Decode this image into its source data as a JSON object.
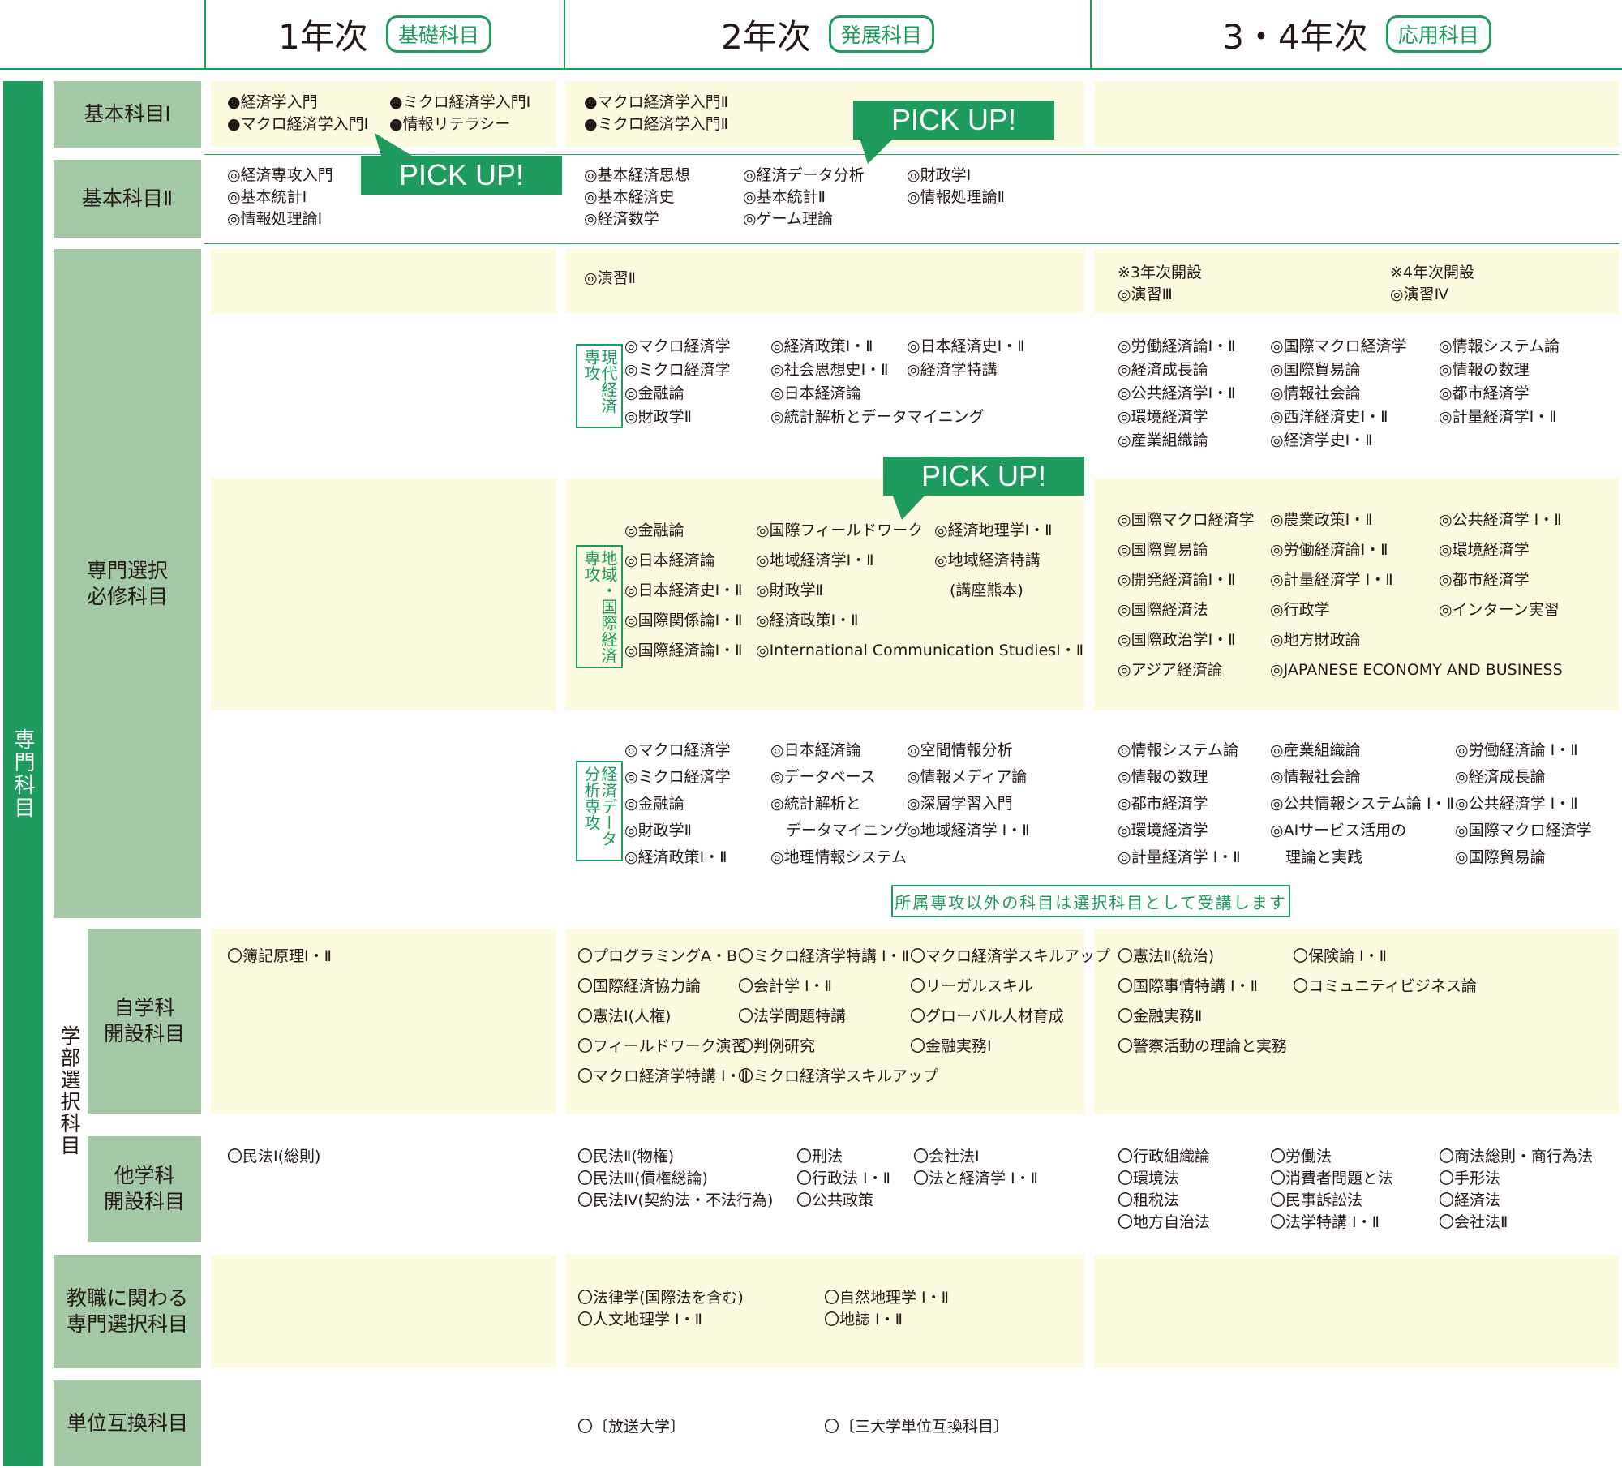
{
  "header": {
    "years": [
      {
        "label": "1年次",
        "tag": "基礎科目"
      },
      {
        "label": "2年次",
        "tag": "発展科目"
      },
      {
        "label": "3・4年次",
        "tag": "応用科目"
      }
    ]
  },
  "sidebar": {
    "main": "専門科目",
    "sub": "学部選択科目"
  },
  "rows": {
    "basic1": {
      "label": "基本科目Ⅰ"
    },
    "basic2": {
      "label": "基本科目Ⅱ"
    },
    "required": {
      "label": "専門選択\n必修科目"
    },
    "own_dept": {
      "label": "自学科\n開設科目"
    },
    "other_dept": {
      "label": "他学科\n開設科目"
    },
    "teacher": {
      "label": "教職に関わる\n専門選択科目"
    },
    "credit": {
      "label": "単位互換科目"
    }
  },
  "pickup": "PICK UP!",
  "note": "所属専攻以外の科目は選択科目として受講します",
  "basic1": {
    "y1": [
      [
        "●経済学入門",
        "●マクロ経済学入門Ⅰ"
      ],
      [
        "●ミクロ経済学入門Ⅰ",
        "●情報リテラシー"
      ]
    ],
    "y2": [
      [
        "●マクロ経済学入門Ⅱ",
        "●ミクロ経済学入門Ⅱ"
      ]
    ]
  },
  "basic2": {
    "y1": [
      [
        "◎経済専攻入門",
        "◎基本統計Ⅰ",
        "◎情報処理論Ⅰ"
      ]
    ],
    "y2": [
      [
        "◎基本経済思想",
        "◎基本経済史",
        "◎経済数学"
      ],
      [
        "◎経済データ分析",
        "◎基本統計Ⅱ",
        "◎ゲーム理論"
      ],
      [
        "◎財政学Ⅰ",
        "◎情報処理論Ⅱ"
      ]
    ]
  },
  "seminar": {
    "y2": "◎演習Ⅱ",
    "y3_note": "※3年次開設",
    "y3": "◎演習Ⅲ",
    "y4_note": "※4年次開設",
    "y4": "◎演習Ⅳ"
  },
  "modern": {
    "tag": "現代経済専攻",
    "y2": [
      [
        "◎マクロ経済学",
        "◎ミクロ経済学",
        "◎金融論",
        "◎財政学Ⅱ"
      ],
      [
        "◎経済政策Ⅰ・Ⅱ",
        "◎社会思想史Ⅰ・Ⅱ",
        "◎日本経済論",
        "◎統計解析とデータマイニング"
      ],
      [
        "◎日本経済史Ⅰ・Ⅱ",
        "◎経済学特講"
      ]
    ],
    "y34": [
      [
        "◎労働経済論Ⅰ・Ⅱ",
        "◎経済成長論",
        "◎公共経済学Ⅰ・Ⅱ",
        "◎環境経済学",
        "◎産業組織論"
      ],
      [
        "◎国際マクロ経済学",
        "◎国際貿易論",
        "◎情報社会論",
        "◎西洋経済史Ⅰ・Ⅱ",
        "◎経済学史Ⅰ・Ⅱ"
      ],
      [
        "◎情報システム論",
        "◎情報の数理",
        "◎都市経済学",
        "◎計量経済学Ⅰ・Ⅱ"
      ]
    ]
  },
  "global": {
    "tag": "地域・国際経済専攻",
    "y2": [
      [
        "◎金融論",
        "◎日本経済論",
        "◎日本経済史Ⅰ・Ⅱ",
        "◎国際関係論Ⅰ・Ⅱ",
        "◎国際経済論Ⅰ・Ⅱ"
      ],
      [
        "◎国際フィールドワーク",
        "◎地域経済学Ⅰ・Ⅱ",
        "◎財政学Ⅱ",
        "◎経済政策Ⅰ・Ⅱ",
        "◎International Communication StudiesⅠ・Ⅱ"
      ],
      [
        "◎経済地理学Ⅰ・Ⅱ",
        "◎地域経済特講",
        "　(講座熊本)"
      ]
    ],
    "y34": [
      [
        "◎国際マクロ経済学",
        "◎国際貿易論",
        "◎開発経済論Ⅰ・Ⅱ",
        "◎国際経済法",
        "◎国際政治学Ⅰ・Ⅱ",
        "◎アジア経済論"
      ],
      [
        "◎農業政策Ⅰ・Ⅱ",
        "◎労働経済論Ⅰ・Ⅱ",
        "◎計量経済学 Ⅰ・Ⅱ",
        "◎行政学",
        "◎地方財政論",
        "◎JAPANESE ECONOMY AND BUSINESS"
      ],
      [
        "◎公共経済学 Ⅰ・Ⅱ",
        "◎環境経済学",
        "◎都市経済学",
        "◎インターン実習"
      ]
    ]
  },
  "analysis": {
    "tag": "経済データ分析専攻",
    "y2": [
      [
        "◎マクロ経済学",
        "◎ミクロ経済学",
        "◎金融論",
        "◎財政学Ⅱ",
        "◎経済政策Ⅰ・Ⅱ"
      ],
      [
        "◎日本経済論",
        "◎データベース",
        "◎統計解析と",
        "　データマイニング",
        "◎地理情報システム"
      ],
      [
        "◎空間情報分析",
        "◎情報メディア論",
        "◎深層学習入門",
        "◎地域経済学 Ⅰ・Ⅱ"
      ]
    ],
    "y34": [
      [
        "◎情報システム論",
        "◎情報の数理",
        "◎都市経済学",
        "◎環境経済学",
        "◎計量経済学 Ⅰ・Ⅱ"
      ],
      [
        "◎産業組織論",
        "◎情報社会論",
        "◎公共情報システム論 Ⅰ・Ⅱ",
        "◎AIサービス活用の",
        "　理論と実践"
      ],
      [
        "◎労働経済論 Ⅰ・Ⅱ",
        "◎経済成長論",
        "◎公共経済学 Ⅰ・Ⅱ",
        "◎国際マクロ経済学",
        "◎国際貿易論"
      ]
    ]
  },
  "own": {
    "y1": [
      [
        "〇簿記原理Ⅰ・Ⅱ"
      ]
    ],
    "y2": [
      [
        "〇プログラミングA・B",
        "〇国際経済協力論",
        "〇憲法Ⅰ(人権)",
        "〇フィールドワーク演習",
        "〇マクロ経済学特講 Ⅰ・Ⅱ"
      ],
      [
        "〇ミクロ経済学特講 Ⅰ・Ⅱ",
        "〇会計学 Ⅰ・Ⅱ",
        "〇法学問題特講",
        "〇判例研究",
        "〇ミクロ経済学スキルアップ"
      ],
      [
        "〇マクロ経済学スキルアップ",
        "〇リーガルスキル",
        "〇グローバル人材育成",
        "〇金融実務Ⅰ"
      ]
    ],
    "y34": [
      [
        "〇憲法Ⅱ(統治)",
        "〇国際事情特講 Ⅰ・Ⅱ",
        "〇金融実務Ⅱ",
        "〇警察活動の理論と実務"
      ],
      [
        "〇保険論 Ⅰ・Ⅱ",
        "〇コミュニティビジネス論"
      ]
    ]
  },
  "other": {
    "y1": [
      [
        "〇民法Ⅰ(総則)"
      ]
    ],
    "y2": [
      [
        "〇民法Ⅱ(物権)",
        "〇民法Ⅲ(債権総論)",
        "〇民法Ⅳ(契約法・不法行為)"
      ],
      [
        "〇刑法",
        "〇行政法 Ⅰ・Ⅱ",
        "〇公共政策"
      ],
      [
        "〇会社法Ⅰ",
        "〇法と経済学 Ⅰ・Ⅱ"
      ]
    ],
    "y34": [
      [
        "〇行政組織論",
        "〇環境法",
        "〇租税法",
        "〇地方自治法"
      ],
      [
        "〇労働法",
        "〇消費者問題と法",
        "〇民事訴訟法",
        "〇法学特講 Ⅰ・Ⅱ"
      ],
      [
        "〇商法総則・商行為法",
        "〇手形法",
        "〇経済法",
        "〇会社法Ⅱ"
      ]
    ]
  },
  "teacher": {
    "y2": [
      [
        "〇法律学(国際法を含む)",
        "〇人文地理学 Ⅰ・Ⅱ"
      ],
      [
        "〇自然地理学 Ⅰ・Ⅱ",
        "〇地誌 Ⅰ・Ⅱ"
      ]
    ]
  },
  "credit": {
    "y2": [
      [
        "〇〔放送大学〕"
      ],
      [
        "〇〔三大学単位互換科目〕"
      ]
    ]
  },
  "colors": {
    "green": "#1e9c5e",
    "label_bg": "#a3c9a7",
    "cell_bg": "#fcfadf"
  }
}
